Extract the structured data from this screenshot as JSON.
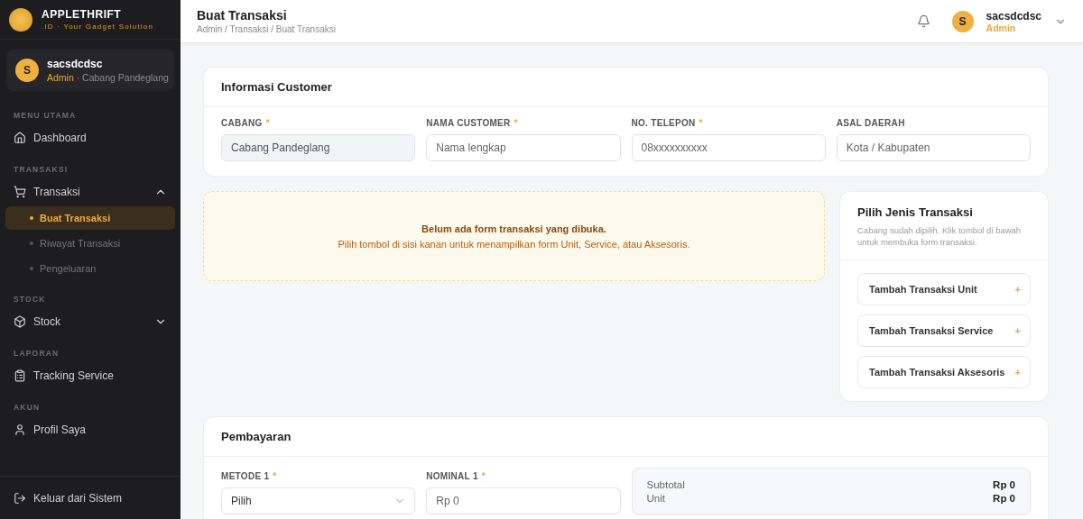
{
  "brand": {
    "name": "APPLETHRIFT",
    "tagline": ".ID · Your Gadget Solution"
  },
  "user_card": {
    "initial": "S",
    "name": "sacsdcdsc",
    "role": "Admin",
    "branch": "· Cabang Pandeglang"
  },
  "sidebar": [
    {
      "kind": "heading",
      "label": "MENU UTAMA"
    },
    {
      "kind": "item",
      "label": "Dashboard"
    },
    {
      "kind": "heading",
      "label": "TRANSAKSI"
    },
    {
      "kind": "item",
      "label": "Transaksi",
      "expanded": true,
      "children": [
        {
          "label": "Buat Transaksi",
          "selected": true
        },
        {
          "label": "Riwayat Transaksi",
          "selected": false
        },
        {
          "label": "Pengeluaran",
          "selected": false
        }
      ]
    },
    {
      "kind": "heading",
      "label": "STOCK"
    },
    {
      "kind": "item",
      "label": "Stock",
      "expanded": false
    },
    {
      "kind": "heading",
      "label": "LAPORAN"
    },
    {
      "kind": "item",
      "label": "Tracking Service"
    },
    {
      "kind": "heading",
      "label": "AKUN"
    },
    {
      "kind": "item",
      "label": "Profil Saya"
    }
  ],
  "logout": "Keluar dari Sistem",
  "header": {
    "title": "Buat Transaksi",
    "breadcrumb": "Admin / Transaksi / Buat Transaksi",
    "user": {
      "initial": "S",
      "name": "sacsdcdsc",
      "role": "Admin"
    }
  },
  "customer": {
    "title": "Informasi Customer",
    "fields": [
      {
        "label": "CABANG",
        "required_mark": "*",
        "value": "Cabang Pandeglang",
        "disabled": true
      },
      {
        "label": "NAMA CUSTOMER",
        "required_mark": "*",
        "placeholder": "Nama lengkap",
        "disabled": false
      },
      {
        "label": "NO. TELEPON",
        "required_mark": "*",
        "placeholder": "08xxxxxxxxxx",
        "disabled": false
      },
      {
        "label": "ASAL DAERAH",
        "placeholder": "Kota / Kabupaten",
        "disabled": false
      }
    ]
  },
  "notice": {
    "title": "Belum ada form transaksi yang dibuka.",
    "text": "Pilih tombol di sisi kanan untuk menampilkan form Unit, Service, atau Aksesoris."
  },
  "picker": {
    "title": "Pilih Jenis Transaksi",
    "hint": "Cabang sudah dipilih. Klik tombol di bawah untuk membuka form transaksi.",
    "buttons": [
      "Tambah Transaksi Unit",
      "Tambah Transaksi Service",
      "Tambah Transaksi Aksesoris"
    ],
    "plus": "+"
  },
  "payment": {
    "title": "Pembayaran",
    "method": {
      "label": "METODE 1",
      "required_mark": "*",
      "value": "Pilih"
    },
    "amount": {
      "label": "NOMINAL 1",
      "required_mark": "*",
      "placeholder": "Rp 0"
    },
    "summary": [
      {
        "label": "Subtotal",
        "value": "Rp 0"
      },
      {
        "label": "Unit",
        "value": "Rp 0"
      }
    ]
  }
}
